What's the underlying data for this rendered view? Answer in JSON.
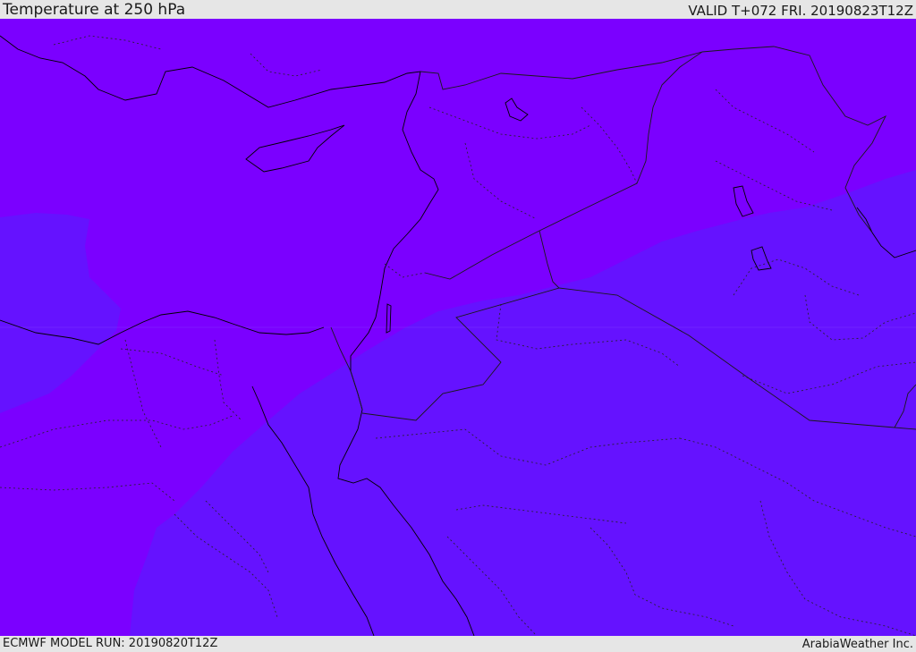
{
  "header": {
    "title": "Temperature at 250 hPa",
    "valid": "VALID T+072 FRI. 20190823T12Z"
  },
  "footer": {
    "model_run": "ECMWF MODEL RUN: 20190820T12Z",
    "credit": "ArabiaWeather Inc."
  },
  "map": {
    "fill_colors": {
      "warmer_band": "#7b00ff",
      "cooler_band": "#6512ff"
    },
    "coastline_color": "#000000",
    "border_color": "#222222"
  }
}
